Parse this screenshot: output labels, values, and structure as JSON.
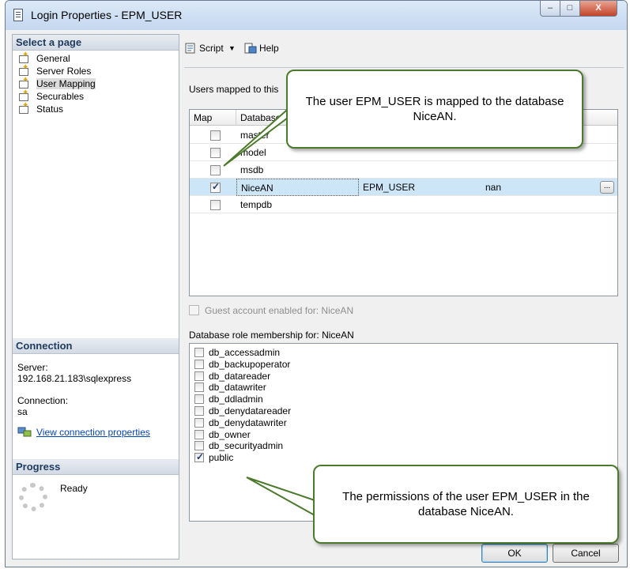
{
  "window": {
    "title": "Login Properties - EPM_USER",
    "min": "–",
    "max": "□",
    "close": "X"
  },
  "left_pane": {
    "select_page_header": "Select a page",
    "pages": [
      {
        "label": "General",
        "selected": false
      },
      {
        "label": "Server Roles",
        "selected": false
      },
      {
        "label": "User Mapping",
        "selected": true
      },
      {
        "label": "Securables",
        "selected": false
      },
      {
        "label": "Status",
        "selected": false
      }
    ],
    "connection_header": "Connection",
    "server_label": "Server:",
    "server_value": "192.168.21.183\\sqlexpress",
    "connection_label": "Connection:",
    "connection_value": "sa",
    "view_connection_link": "View connection properties",
    "progress_header": "Progress",
    "progress_status": "Ready"
  },
  "toolbar": {
    "script_label": "Script",
    "dropdown_arrow": "▼",
    "help_label": "Help"
  },
  "users_mapped": {
    "label": "Users mapped to this",
    "columns": [
      "Map",
      "Database"
    ],
    "rows": [
      {
        "map": false,
        "database": "master",
        "user": "",
        "schema": ""
      },
      {
        "map": false,
        "database": "model",
        "user": "",
        "schema": ""
      },
      {
        "map": false,
        "database": "msdb",
        "user": "",
        "schema": ""
      },
      {
        "map": true,
        "database": "NiceAN",
        "user": "EPM_USER",
        "schema": "nan",
        "selected": true
      },
      {
        "map": false,
        "database": "tempdb",
        "user": "",
        "schema": ""
      }
    ],
    "ellipsis": "..."
  },
  "guest_account": {
    "label": "Guest account enabled for: NiceAN",
    "checked": false
  },
  "roles": {
    "label": "Database role membership for: NiceAN",
    "items": [
      {
        "name": "db_accessadmin",
        "checked": false
      },
      {
        "name": "db_backupoperator",
        "checked": false
      },
      {
        "name": "db_datareader",
        "checked": false
      },
      {
        "name": "db_datawriter",
        "checked": false
      },
      {
        "name": "db_ddladmin",
        "checked": false
      },
      {
        "name": "db_denydatareader",
        "checked": false
      },
      {
        "name": "db_denydatawriter",
        "checked": false
      },
      {
        "name": "db_owner",
        "checked": false
      },
      {
        "name": "db_securityadmin",
        "checked": false
      },
      {
        "name": "public",
        "checked": true
      }
    ]
  },
  "buttons": {
    "ok": "OK",
    "cancel": "Cancel"
  },
  "callouts": {
    "top": "The user EPM_USER is mapped to the database NiceAN.",
    "bottom": "The permissions of the user EPM_USER in the database NiceAN."
  },
  "colors": {
    "callout_border": "#4b7a2c",
    "selection": "#cde6f7",
    "link": "#0645ad"
  }
}
